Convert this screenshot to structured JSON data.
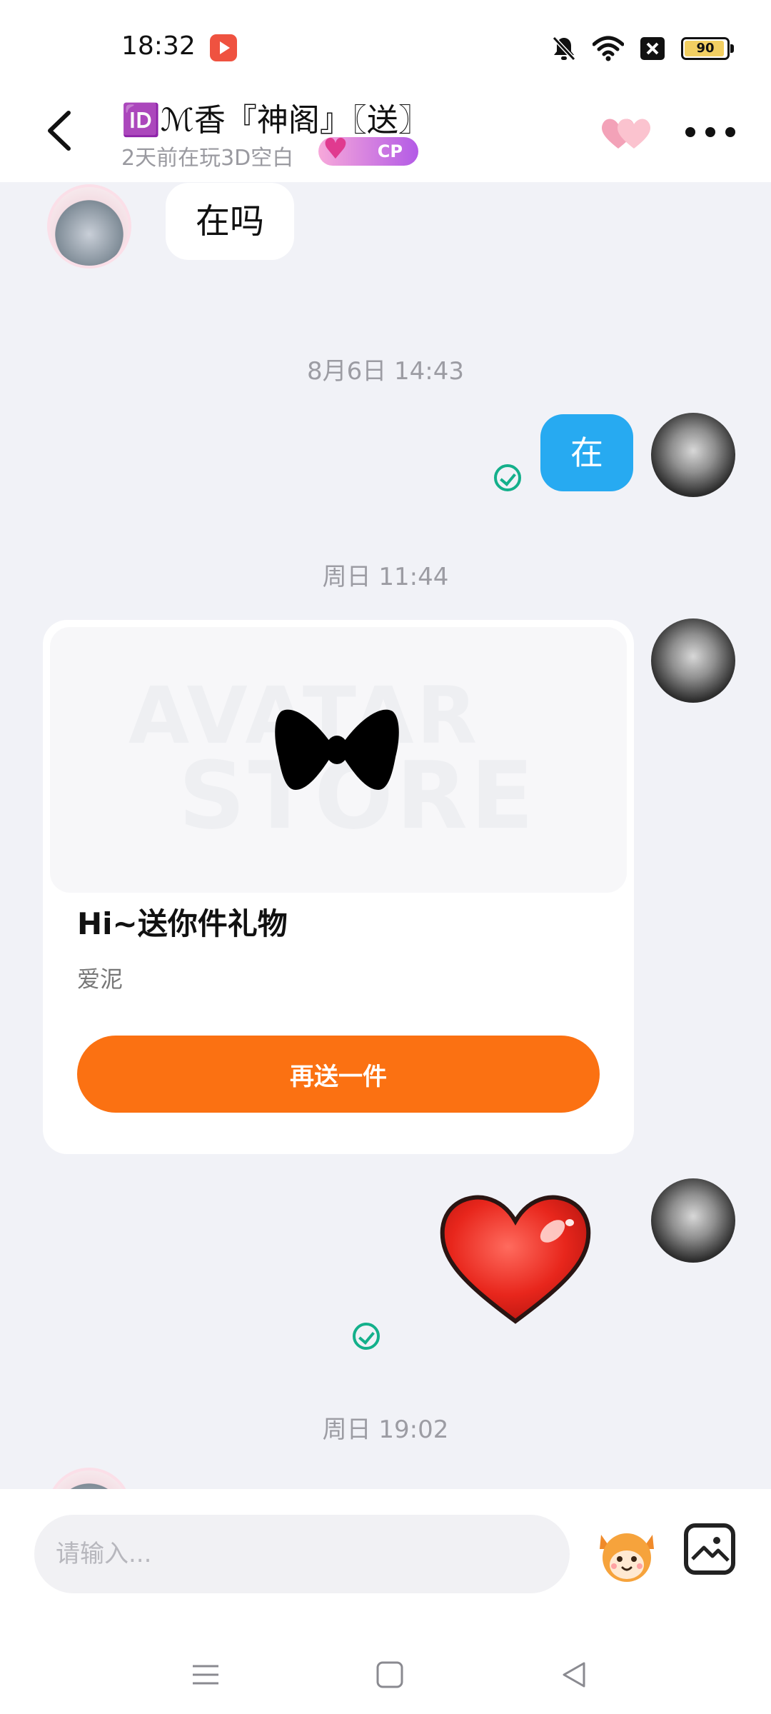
{
  "status_bar": {
    "time": "18:32",
    "battery": "90",
    "icons": [
      "red-app-notification-icon",
      "mute-bell-icon",
      "wifi-icon",
      "sim-x-icon",
      "battery-icon"
    ]
  },
  "header": {
    "title": "🆔ℳ香『神阁』〖送〗",
    "subtitle": "2天前在玩3D空白",
    "cp_badge": "CP"
  },
  "messages": [
    {
      "type": "text",
      "from": "other",
      "text": "在吗"
    },
    {
      "type": "time",
      "text": "8月6日 14:43"
    },
    {
      "type": "text",
      "from": "me",
      "text": "在",
      "read": true
    },
    {
      "type": "time",
      "text": "周日 11:44"
    },
    {
      "type": "gift",
      "from": "me",
      "title": "Hi~送你件礼物",
      "sender": "爱泥",
      "button": "再送一件",
      "watermark_top": "AVATAR",
      "watermark_bottom": "STORE"
    },
    {
      "type": "sticker",
      "from": "me",
      "sticker": "heart",
      "read": true
    },
    {
      "type": "time",
      "text": "周日 19:02"
    }
  ],
  "input": {
    "placeholder": "请输入..."
  },
  "colors": {
    "accent_blue": "#27aaf1",
    "gift_button_orange": "#fb7112",
    "read_check_green": "#14b08b",
    "chat_background": "#f1f2f7"
  }
}
